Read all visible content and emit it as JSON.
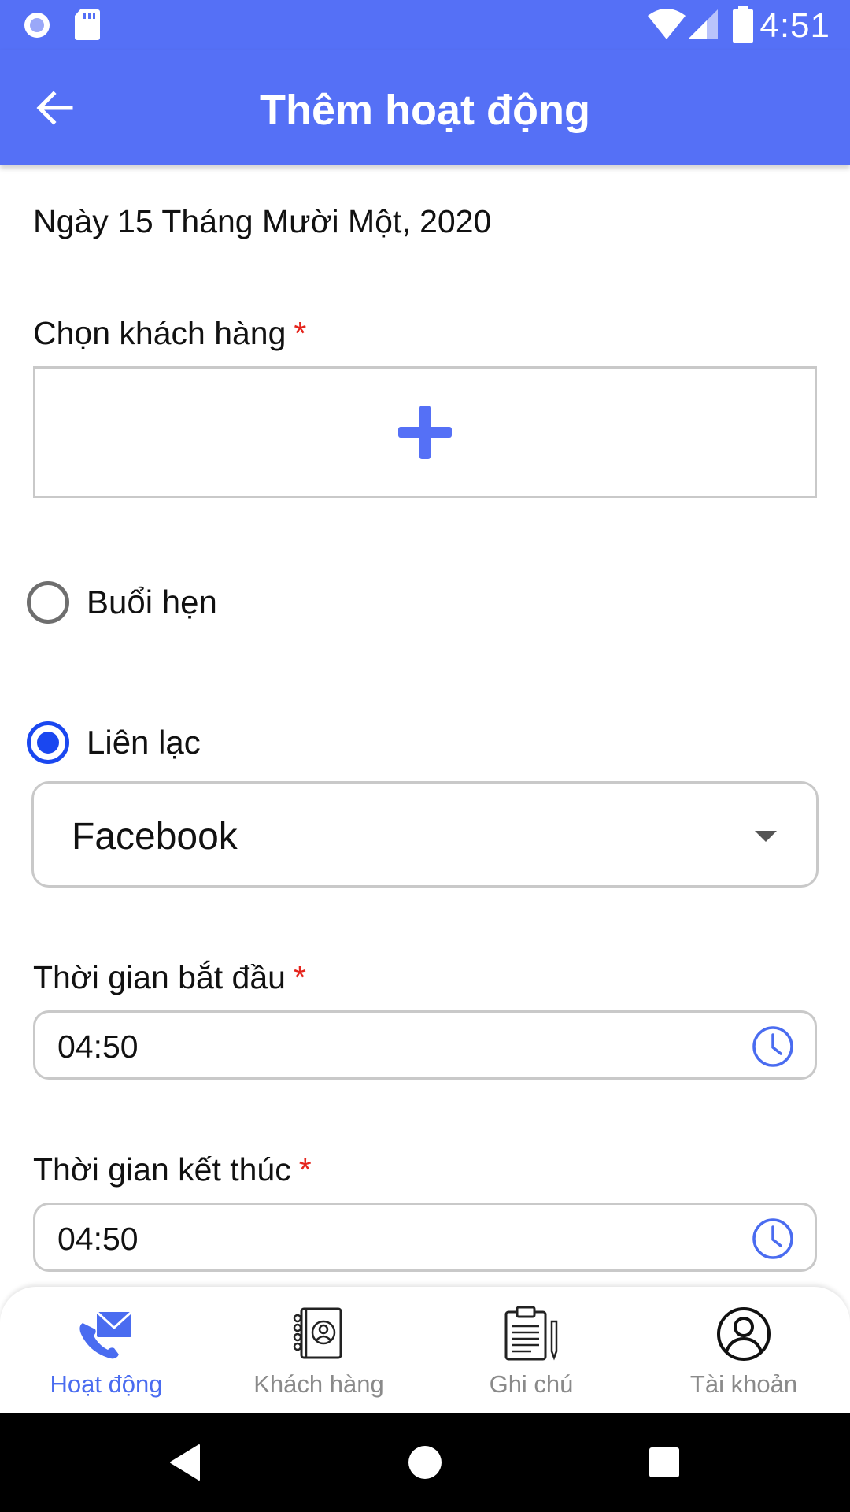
{
  "status_bar": {
    "time": "4:51",
    "icons": [
      "notification-dot-icon",
      "sd-card-icon",
      "wifi-icon",
      "cell-signal-icon",
      "battery-icon"
    ]
  },
  "app_bar": {
    "title": "Thêm hoạt động",
    "back_icon": "arrow-left-icon"
  },
  "form": {
    "date_text": "Ngày 15 Tháng Mười Một, 2020",
    "customer": {
      "label": "Chọn khách hàng",
      "required_mark": "*",
      "add_icon": "plus-icon"
    },
    "radio_appointment": {
      "label": "Buổi hẹn",
      "checked": false
    },
    "radio_contact": {
      "label": "Liên lạc",
      "checked": true
    },
    "contact_method": {
      "value": "Facebook"
    },
    "start_time": {
      "label": "Thời gian bắt đầu",
      "required_mark": "*",
      "value": "04:50"
    },
    "end_time": {
      "label": "Thời gian kết thúc",
      "required_mark": "*",
      "value": "04:50"
    }
  },
  "bottom_nav": {
    "items": [
      {
        "label": "Hoạt động",
        "icon": "phone-mail-icon",
        "active": true
      },
      {
        "label": "Khách hàng",
        "icon": "contacts-book-icon",
        "active": false
      },
      {
        "label": "Ghi chú",
        "icon": "clipboard-note-icon",
        "active": false
      },
      {
        "label": "Tài khoản",
        "icon": "user-circle-icon",
        "active": false
      }
    ]
  },
  "colors": {
    "primary": "#5570f6",
    "radio_checked": "#1a47f0",
    "required": "#e5251d",
    "nav_active": "#4a6cf0",
    "nav_inactive": "#8a8a8a"
  }
}
